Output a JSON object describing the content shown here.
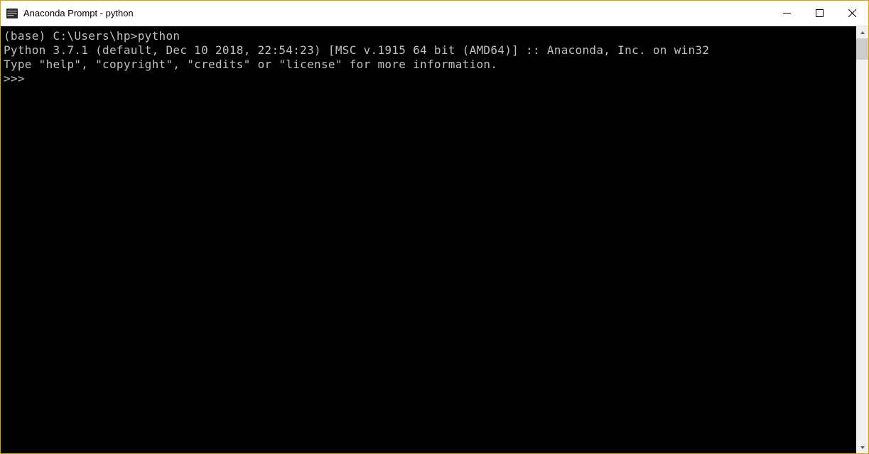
{
  "window": {
    "title": "Anaconda Prompt - python"
  },
  "terminal": {
    "line1": "(base) C:\\Users\\hp>python",
    "line2": "Python 3.7.1 (default, Dec 10 2018, 22:54:23) [MSC v.1915 64 bit (AMD64)] :: Anaconda, Inc. on win32",
    "line3": "Type \"help\", \"copyright\", \"credits\" or \"license\" for more information.",
    "prompt": ">>> "
  }
}
